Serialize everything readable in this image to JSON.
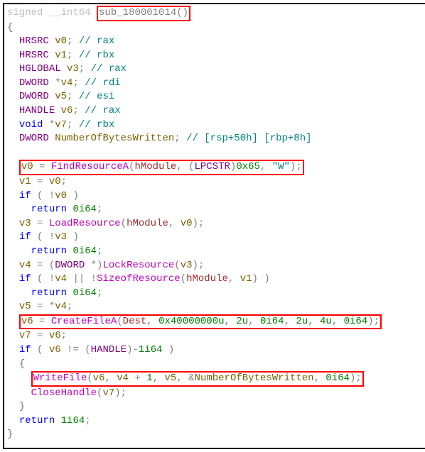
{
  "sig": {
    "ret": "signed __int64 ",
    "fn": "sub_180001014()"
  },
  "braces": {
    "open": "{",
    "close": "}"
  },
  "decls": [
    {
      "indent": "  ",
      "type": "HRSRC ",
      "name": "v0",
      "sep": "; ",
      "cmt": "// rax"
    },
    {
      "indent": "  ",
      "type": "HRSRC ",
      "name": "v1",
      "sep": "; ",
      "cmt": "// rbx"
    },
    {
      "indent": "  ",
      "type": "HGLOBAL ",
      "name": "v3",
      "sep": "; ",
      "cmt": "// rax"
    },
    {
      "indent": "  ",
      "type": "DWORD ",
      "ptr": "*",
      "name": "v4",
      "sep": "; ",
      "cmt": "// rdi"
    },
    {
      "indent": "  ",
      "type": "DWORD ",
      "name": "v5",
      "sep": "; ",
      "cmt": "// esi"
    },
    {
      "indent": "  ",
      "type": "HANDLE ",
      "name": "v6",
      "sep": "; ",
      "cmt": "// rax"
    },
    {
      "indent": "  ",
      "type": "void ",
      "ptr": "*",
      "name": "v7",
      "sep": "; ",
      "cmt": "// rbx"
    },
    {
      "indent": "  ",
      "type": "DWORD ",
      "name": "NumberOfBytesWritten",
      "sep": "; ",
      "cmt": "// [rsp+50h] [rbp+8h]"
    }
  ],
  "b": {
    "i2": "  ",
    "i4": "    ",
    "l1": {
      "lhs": "v0",
      "eq": " = ",
      "fn": "FindResourceA",
      "op": "(",
      "a1": "hModule",
      "c1": ", (",
      "a2t": "LPCSTR",
      "c2": ")",
      "a2v": "0x65",
      "c3": ", ",
      "a3": "\"W\"",
      "cp": ");"
    },
    "l2": {
      "lhs": "v1",
      "eq": " = ",
      "rhs": "v0",
      "t": ";"
    },
    "l3": {
      "kw": "if",
      "op": " ( !",
      "v": "v0",
      "cp": " )"
    },
    "l4": {
      "kw": "return",
      "sp": " ",
      "v": "0i64",
      "t": ";"
    },
    "l5": {
      "lhs": "v3",
      "eq": " = ",
      "fn": "LoadResource",
      "op": "(",
      "a1": "hModule",
      "c1": ", ",
      "a2": "v0",
      "cp": ");"
    },
    "l6": {
      "kw": "if",
      "op": " ( !",
      "v": "v3",
      "cp": " )"
    },
    "l7": {
      "kw": "return",
      "sp": " ",
      "v": "0i64",
      "t": ";"
    },
    "l8": {
      "lhs": "v4",
      "eq": " = (",
      "ty": "DWORD ",
      "st": "*)",
      "fn": "LockResource",
      "op": "(",
      "a1": "v3",
      "cp": ");"
    },
    "l9": {
      "kw": "if",
      "op": " ( !",
      "v1": "v4",
      "mid": " || !",
      "fn": "SizeofResource",
      "p1": "(",
      "a1": "hModule",
      "c1": ", ",
      "a2": "v1",
      "cp": ") )"
    },
    "l10": {
      "kw": "return",
      "sp": " ",
      "v": "0i64",
      "t": ";"
    },
    "l11": {
      "lhs": "v5",
      "eq": " = *",
      "rhs": "v4",
      "t": ";"
    },
    "l12": {
      "lhs": "v6",
      "eq": " = ",
      "fn": "CreateFileA",
      "op": "(",
      "a1": "Dest",
      "c1": ", ",
      "a2": "0x40000000u",
      "c2": ", ",
      "a3": "2u",
      "c3": ", ",
      "a4": "0i64",
      "c4": ", ",
      "a5": "2u",
      "c5": ", ",
      "a6": "4u",
      "c6": ", ",
      "a7": "0i64",
      "cp": ");"
    },
    "l13": {
      "lhs": "v7",
      "eq": " = ",
      "rhs": "v6",
      "t": ";"
    },
    "l14": {
      "kw": "if",
      "op": " ( ",
      "v": "v6",
      "mid": " != (",
      "ty": "HANDLE",
      "cp1": ")-",
      "n": "1i64",
      "cp2": " )"
    },
    "l15": "{",
    "l16": {
      "fn": "WriteFile",
      "op": "(",
      "a1": "v6",
      "c1": ", ",
      "a2": "v4",
      "plus": " + ",
      "one": "1",
      "c2": ", ",
      "a3": "v5",
      "c3": ", ",
      "amp": "&",
      "a4": "NumberOfBytesWritten",
      "c4": ", ",
      "a5": "0i64",
      "cp": ");"
    },
    "l17": {
      "fn": "CloseHandle",
      "op": "(",
      "a1": "v7",
      "cp": ");"
    },
    "l18": "}",
    "l19": {
      "kw": "return",
      "sp": " ",
      "v": "1i64",
      "t": ";"
    }
  }
}
